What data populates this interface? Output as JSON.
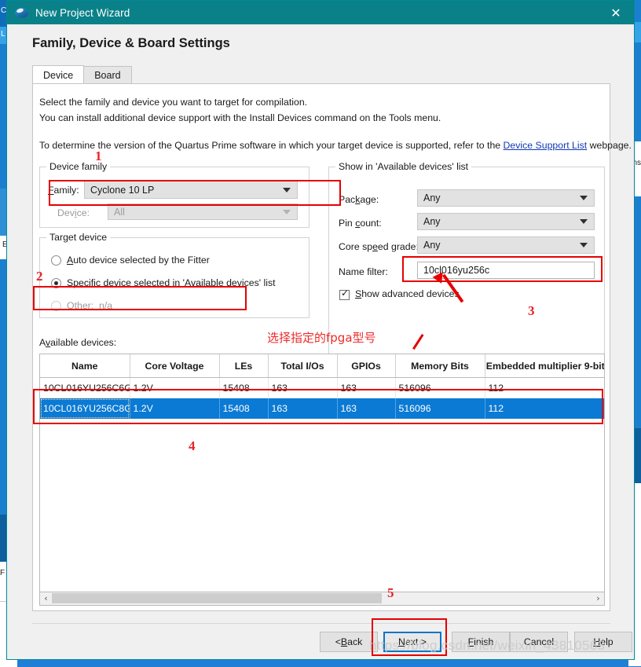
{
  "window": {
    "title": "New Project Wizard",
    "icon": "quartus-logo-icon",
    "close_label": "✕",
    "titlebar_color": "#0a8189"
  },
  "page_title": "Family, Device & Board Settings",
  "tabs": [
    {
      "label": "Device",
      "active": true
    },
    {
      "label": "Board",
      "active": false
    }
  ],
  "description": {
    "line1": "Select the family and device you want to target for compilation.",
    "line2": "You can install additional device support with the Install Devices command on the Tools menu.",
    "line3_prefix": "To determine the version of the Quartus Prime software in which your target device is supported, refer to the ",
    "line3_link": "Device Support List",
    "line3_suffix": " webpage."
  },
  "device_family": {
    "legend": "Device family",
    "family_label": "Family:",
    "family_value": "Cyclone 10 LP",
    "device_label": "Device:",
    "device_value": "All"
  },
  "target_device": {
    "legend": "Target device",
    "options": [
      {
        "label": "Auto device selected by the Fitter",
        "selected": false,
        "enabled": true
      },
      {
        "label": "Specific device selected in 'Available devices' list",
        "selected": true,
        "enabled": true
      }
    ],
    "other_label": "Other:",
    "other_value": "n/a"
  },
  "show_in_list": {
    "legend": "Show in 'Available devices' list",
    "package_label": "Package:",
    "package_value": "Any",
    "pin_count_label": "Pin count:",
    "pin_count_value": "Any",
    "core_speed_label": "Core speed grade:",
    "core_speed_value": "Any",
    "name_filter_label": "Name filter:",
    "name_filter_value": "10cl016yu256c",
    "show_advanced_label": "Show advanced devices",
    "show_advanced_checked": true,
    "check_glyph": "✓"
  },
  "available_devices": {
    "label": "Available devices:",
    "columns": [
      "Name",
      "Core Voltage",
      "LEs",
      "Total I/Os",
      "GPIOs",
      "Memory Bits",
      "Embedded multiplier 9-bit"
    ],
    "rows": [
      {
        "selected": false,
        "cells": [
          "10CL016YU256C6G",
          "1.2V",
          "15408",
          "163",
          "163",
          "516096",
          "112"
        ]
      },
      {
        "selected": true,
        "cells": [
          "10CL016YU256C8G",
          "1.2V",
          "15408",
          "163",
          "163",
          "516096",
          "112"
        ]
      }
    ],
    "selection_color": "#0b7ad4",
    "scroll_left_glyph": "‹",
    "scroll_right_glyph": "›"
  },
  "footer": {
    "back": "< Back",
    "next": "Next >",
    "finish": "Finish",
    "cancel": "Cancel",
    "help": "Help"
  },
  "annotations": {
    "n1": "1",
    "n2": "2",
    "n3": "3",
    "n4": "4",
    "n5": "5",
    "chinese_note": "选择指定的fpga型号",
    "color": "#e60000"
  },
  "watermark": "https://blog.csdn.net/weixin_43810563",
  "background_text": {
    "t1": "C",
    "t2": "L",
    "t3": "E",
    "t4": "F i",
    "t5": "ns"
  }
}
